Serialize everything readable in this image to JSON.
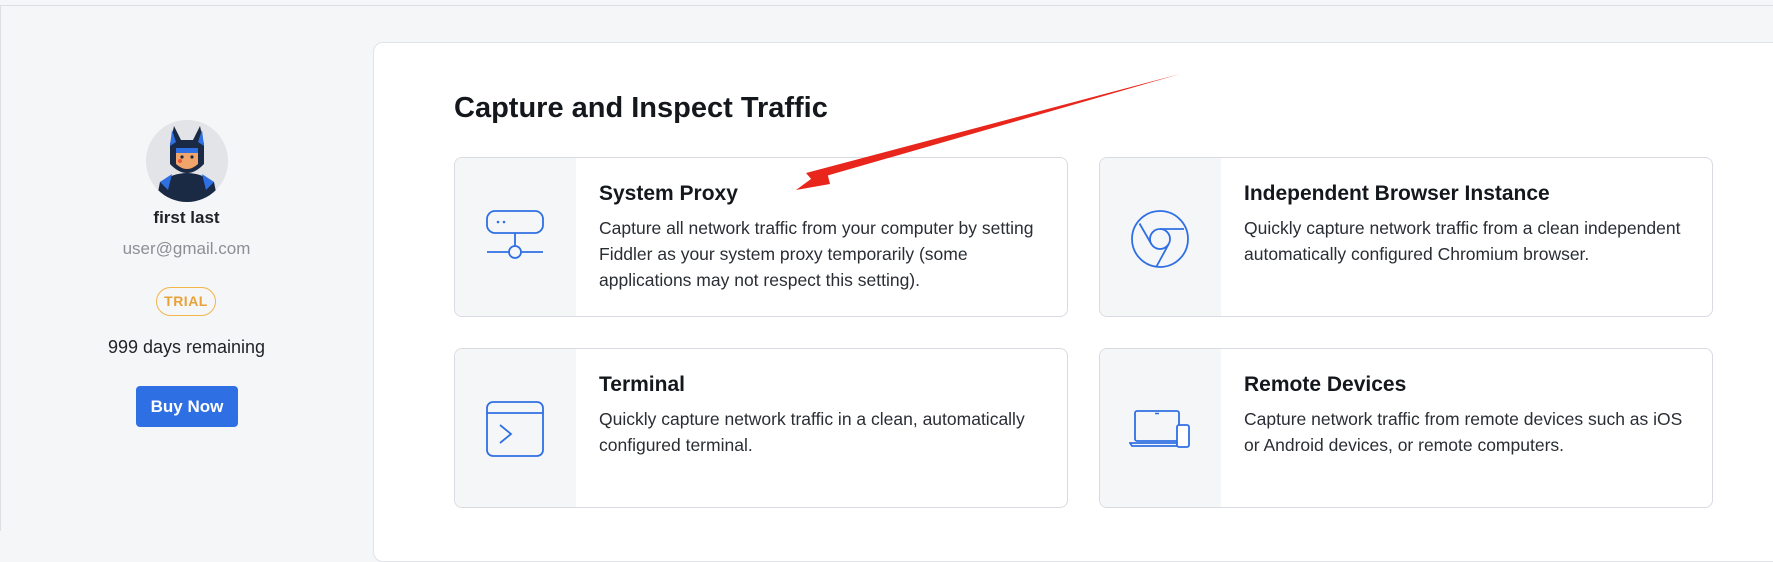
{
  "sidebar": {
    "user_name": "first last",
    "user_email": "user@gmail.com",
    "badge": "TRIAL",
    "days_remaining": "999 days remaining",
    "buy_label": "Buy Now"
  },
  "main": {
    "title": "Capture and Inspect Traffic",
    "cards": [
      {
        "title": "System Proxy",
        "description": "Capture all network traffic from your computer by setting Fiddler as your system proxy temporarily (some applications may not respect this setting).",
        "icon": "proxy-server-icon"
      },
      {
        "title": "Independent Browser Instance",
        "description": "Quickly capture network traffic from a clean independent automatically configured Chromium browser.",
        "icon": "chromium-icon"
      },
      {
        "title": "Terminal",
        "description": "Quickly capture network traffic in a clean, automatically configured terminal.",
        "icon": "terminal-icon"
      },
      {
        "title": "Remote Devices",
        "description": "Capture network traffic from remote devices such as iOS or Android devices, or remote computers.",
        "icon": "laptop-phone-icon"
      }
    ]
  },
  "colors": {
    "accent": "#2f6fe4",
    "badge": "#e8a23a",
    "annotation_arrow": "#e8261c"
  }
}
